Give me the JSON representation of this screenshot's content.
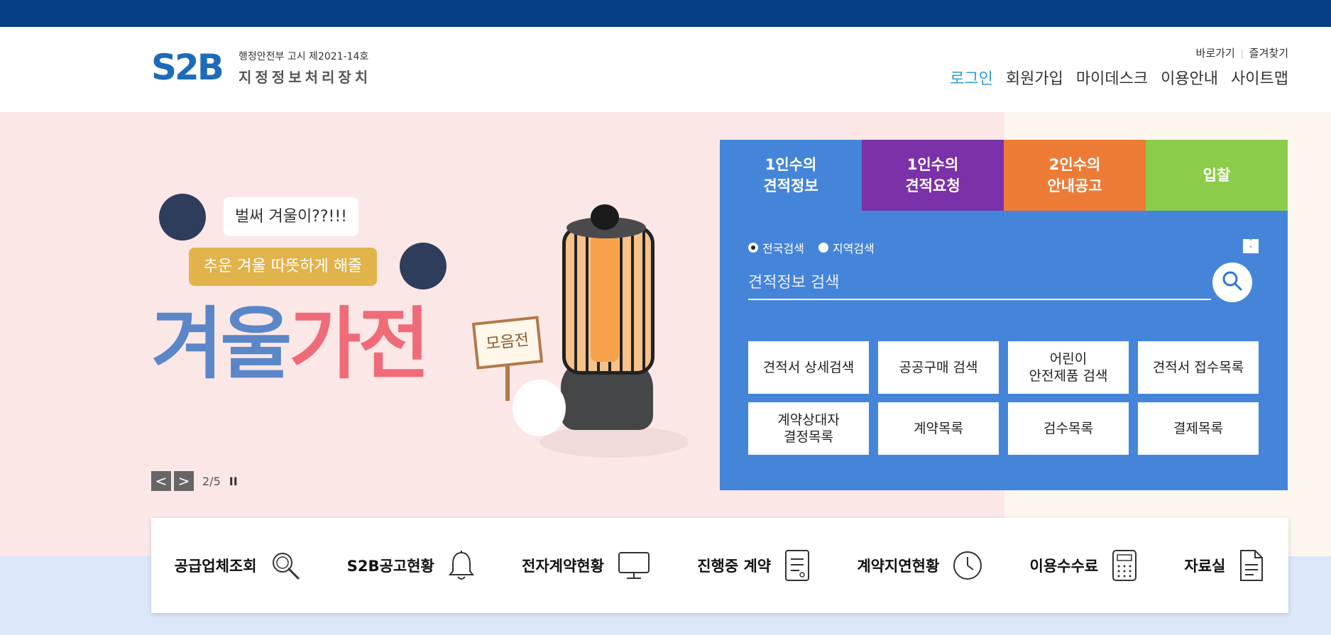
{
  "header": {
    "logo_text": "S2B",
    "notice": "행정안전부 고시 제2021-14호",
    "org_name": "지정정보처리장치",
    "util_links": [
      "바로가기",
      "즐겨찾기"
    ],
    "nav": [
      "로그인",
      "회원가입",
      "마이데스크",
      "이용안내",
      "사이트맵"
    ]
  },
  "banner": {
    "bubble1": "벌써 겨울이??!!!",
    "bubble2": "추운 겨울 따뜻하게 해줄",
    "headline_part1": "겨울",
    "headline_part2": "가전",
    "sign": "모음전",
    "counter": "2/5",
    "prev_label": "<",
    "next_label": ">",
    "pause_label": "II"
  },
  "panel": {
    "tabs": [
      "1인수의\n견적정보",
      "1인수의\n견적요청",
      "2인수의\n안내공고",
      "입찰"
    ],
    "tab_colors": [
      "#4585d9",
      "#7b31a8",
      "#ed7b35",
      "#8bcd4a"
    ],
    "radio_options": [
      "전국검색",
      "지역검색"
    ],
    "radio_selected": "전국검색",
    "search_placeholder": "견적정보 검색",
    "quick_buttons": [
      "견적서 상세검색",
      "공공구매 검색",
      "어린이\n안전제품 검색",
      "견적서 접수목록",
      "계약상대자\n결정목록",
      "계약목록",
      "검수목록",
      "결제목록"
    ]
  },
  "quicklinks": [
    {
      "label": "공급업체조회",
      "icon": "search-icon"
    },
    {
      "label": "S2B공고현황",
      "icon": "bell-icon"
    },
    {
      "label": "전자계약현황",
      "icon": "monitor-icon"
    },
    {
      "label": "진행중 계약",
      "icon": "document-icon"
    },
    {
      "label": "계약지연현황",
      "icon": "clock-icon"
    },
    {
      "label": "이용수수료",
      "icon": "calculator-icon"
    },
    {
      "label": "자료실",
      "icon": "file-icon"
    }
  ],
  "colors": {
    "topbar": "#063f86",
    "panel": "#4585d9",
    "logo": "#1e6bb8",
    "login_link": "#2a9dd4"
  }
}
